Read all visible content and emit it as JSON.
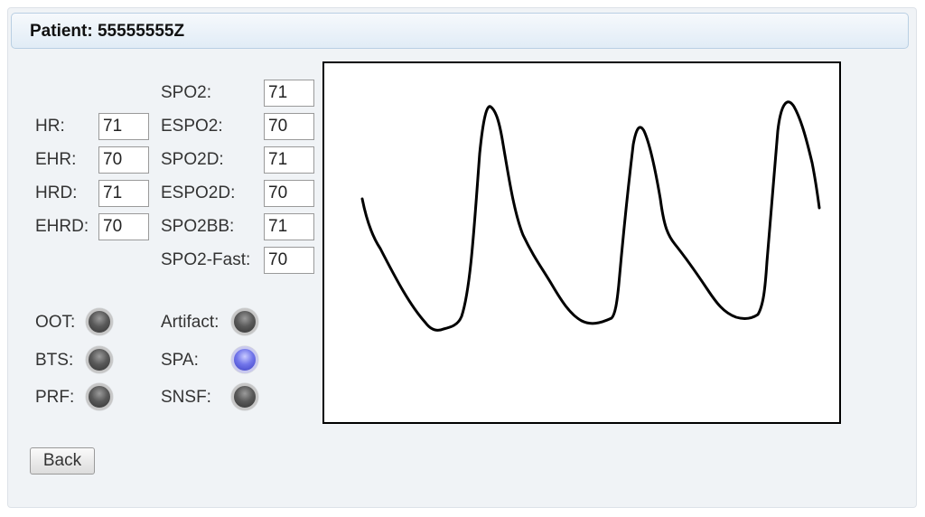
{
  "header": {
    "title": "Patient: 55555555Z"
  },
  "vitals_left": [
    {
      "label": "HR:",
      "value": "71"
    },
    {
      "label": "EHR:",
      "value": "70"
    },
    {
      "label": "HRD:",
      "value": "71"
    },
    {
      "label": "EHRD:",
      "value": "70"
    }
  ],
  "vitals_right": [
    {
      "label": "SPO2:",
      "value": "71"
    },
    {
      "label": "ESPO2:",
      "value": "70"
    },
    {
      "label": "SPO2D:",
      "value": "71"
    },
    {
      "label": "ESPO2D:",
      "value": "70"
    },
    {
      "label": "SPO2BB:",
      "value": "71"
    },
    {
      "label": "SPO2-Fast:",
      "value": "70"
    }
  ],
  "indicators_left": [
    {
      "label": "OOT:",
      "state": "off"
    },
    {
      "label": "BTS:",
      "state": "off"
    },
    {
      "label": "PRF:",
      "state": "off"
    }
  ],
  "indicators_right": [
    {
      "label": "Artifact:",
      "state": "off"
    },
    {
      "label": "SPA:",
      "state": "on"
    },
    {
      "label": "SNSF:",
      "state": "off"
    }
  ],
  "colors": {
    "indicator_on": "#6b6fe8",
    "indicator_off": "#5a5a5a",
    "waveform": "#000000"
  },
  "back_button": {
    "label": "Back"
  }
}
